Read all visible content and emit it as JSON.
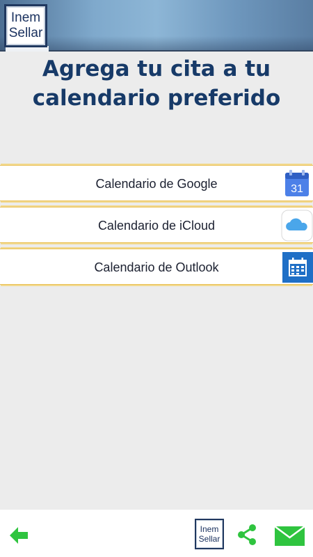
{
  "header": {
    "logo_line1": "Inem",
    "logo_line2": "Sellar"
  },
  "title": "Agrega tu cita a tu calendario preferido",
  "options": [
    {
      "label": "Calendario de Google",
      "icon": "google-calendar-icon",
      "icon_text": "31"
    },
    {
      "label": "Calendario de iCloud",
      "icon": "icloud-icon"
    },
    {
      "label": "Calendario de Outlook",
      "icon": "outlook-calendar-icon"
    }
  ],
  "bottom_bar": {
    "back_icon": "back-arrow-icon",
    "logo_line1": "Inem",
    "logo_line2": "Sellar",
    "share_icon": "share-icon",
    "mail_icon": "mail-icon"
  },
  "colors": {
    "title": "#173a68",
    "accent_border": "#e9bf55",
    "green": "#2fc43f",
    "outlook_blue": "#1f6fc6",
    "google_blue": "#4c80e8"
  }
}
